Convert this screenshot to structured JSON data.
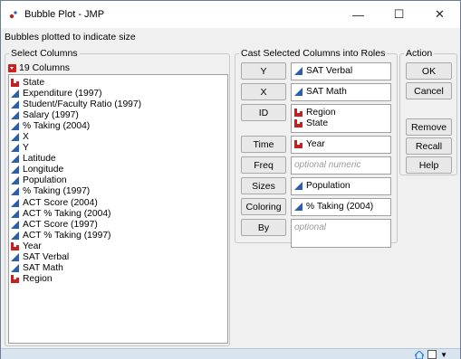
{
  "window": {
    "title": "Bubble Plot - JMP",
    "minimize": "—",
    "maximize": "☐",
    "close": "✕"
  },
  "hint": "Bubbles plotted to indicate size",
  "select_columns": {
    "label": "Select Columns",
    "count_label": "19 Columns",
    "columns": [
      {
        "name": "State",
        "type": "nominal"
      },
      {
        "name": "Expenditure (1997)",
        "type": "continuous"
      },
      {
        "name": "Student/Faculty Ratio (1997)",
        "type": "continuous"
      },
      {
        "name": "Salary (1997)",
        "type": "continuous"
      },
      {
        "name": "% Taking (2004)",
        "type": "continuous"
      },
      {
        "name": "X",
        "type": "continuous"
      },
      {
        "name": "Y",
        "type": "continuous"
      },
      {
        "name": "Latitude",
        "type": "continuous"
      },
      {
        "name": "Longitude",
        "type": "continuous"
      },
      {
        "name": "Population",
        "type": "continuous"
      },
      {
        "name": "% Taking (1997)",
        "type": "continuous"
      },
      {
        "name": "ACT Score (2004)",
        "type": "continuous"
      },
      {
        "name": "ACT % Taking (2004)",
        "type": "continuous"
      },
      {
        "name": "ACT Score (1997)",
        "type": "continuous"
      },
      {
        "name": "ACT % Taking (1997)",
        "type": "continuous"
      },
      {
        "name": "Year",
        "type": "nominal"
      },
      {
        "name": "SAT Verbal",
        "type": "continuous"
      },
      {
        "name": "SAT Math",
        "type": "continuous"
      },
      {
        "name": "Region",
        "type": "nominal"
      }
    ]
  },
  "cast_roles": {
    "label": "Cast Selected Columns into Roles",
    "roles": [
      {
        "button": "Y",
        "items": [
          {
            "name": "SAT Verbal",
            "type": "continuous"
          }
        ]
      },
      {
        "button": "X",
        "items": [
          {
            "name": "SAT Math",
            "type": "continuous"
          }
        ]
      },
      {
        "button": "ID",
        "items": [
          {
            "name": "Region",
            "type": "nominal"
          },
          {
            "name": "State",
            "type": "nominal"
          }
        ]
      },
      {
        "button": "Time",
        "items": [
          {
            "name": "Year",
            "type": "nominal"
          }
        ]
      },
      {
        "button": "Freq",
        "placeholder": "optional numeric",
        "items": []
      },
      {
        "button": "Sizes",
        "items": [
          {
            "name": "Population",
            "type": "continuous"
          }
        ]
      },
      {
        "button": "Coloring",
        "items": [
          {
            "name": "% Taking (2004)",
            "type": "continuous"
          }
        ]
      },
      {
        "button": "By",
        "placeholder": "optional",
        "items": []
      }
    ]
  },
  "action": {
    "label": "Action",
    "ok": "OK",
    "cancel": "Cancel",
    "remove": "Remove",
    "recall": "Recall",
    "help": "Help"
  },
  "status": {
    "home_icon": "home-icon",
    "dropdown": "▼"
  },
  "colors": {
    "continuous": "#2b5fa8",
    "nominal": "#c42020",
    "statusbar": "#d9e4f1"
  }
}
